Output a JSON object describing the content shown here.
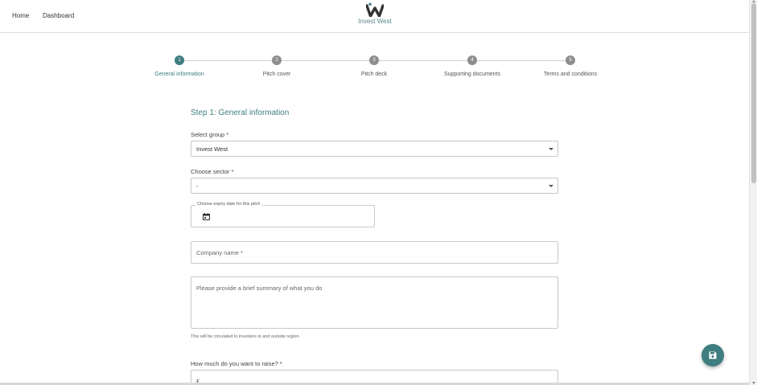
{
  "header": {
    "nav": {
      "home": "Home",
      "dashboard": "Dashboard"
    },
    "logo_text": "Invest West"
  },
  "stepper": {
    "steps": [
      {
        "number": "1",
        "label": "General information",
        "active": true
      },
      {
        "number": "2",
        "label": "Pitch cover",
        "active": false
      },
      {
        "number": "3",
        "label": "Pitch deck",
        "active": false
      },
      {
        "number": "4",
        "label": "Supporting documents",
        "active": false
      },
      {
        "number": "5",
        "label": "Terms and conditions",
        "active": false
      }
    ]
  },
  "form": {
    "title": "Step 1: General information",
    "group": {
      "label": "Select group *",
      "value": "Invest West"
    },
    "sector": {
      "label": "Choose sector *",
      "value": "-"
    },
    "expiry": {
      "legend": "Choose expiry date for this pitch",
      "icon": "calendar-icon"
    },
    "company_name": {
      "placeholder": "Company name *"
    },
    "summary": {
      "placeholder": "Please provide a brief summary of what you do",
      "helper": "This will be circulated to investors in and outside region."
    },
    "raise": {
      "label": "How much do you want to raise? *",
      "prefix": "£"
    }
  },
  "fab": {
    "icon": "save-icon"
  },
  "colors": {
    "accent": "#3f7e80",
    "inactive_step": "#8e8e8e"
  }
}
